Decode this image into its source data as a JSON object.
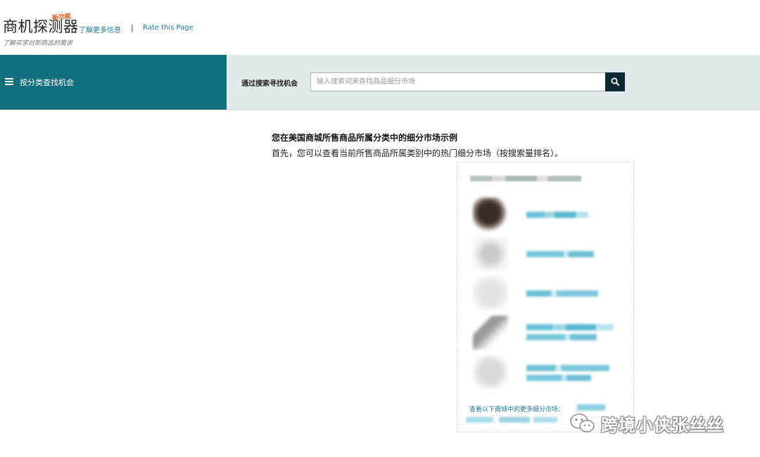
{
  "header": {
    "app_title": "商机探测器",
    "beta_badge": "新功能",
    "learn_more_link": "了解更多信息",
    "separator": "|",
    "rate_link": "Rate this Page",
    "subtitle": "了解买家对新商品的需求"
  },
  "navbar": {
    "category_label": "按分类查找机会",
    "search_label": "通过搜索寻找机会",
    "search_placeholder": "输入搜索词来查找商品细分市场",
    "search_value": ""
  },
  "main": {
    "section_title": "您在美国商城所售商品所属分类中的细分市场示例",
    "section_desc": "首先，您可以查看当前所售商品所属类别中的热门细分市场（按搜索量排名）。",
    "card": {
      "footer_text": "查看以下商城中的更多细分市场："
    }
  },
  "watermark": {
    "text": "跨境小侠张丝丝"
  },
  "colors": {
    "accent_teal": "#0f6f7e",
    "search_button": "#0c2a33",
    "link_blue": "#1c7a9a",
    "badge_orange": "#e8561c"
  },
  "icons": {
    "menu": "hamburger-menu-icon",
    "search": "search-icon",
    "wechat": "wechat-icon"
  }
}
